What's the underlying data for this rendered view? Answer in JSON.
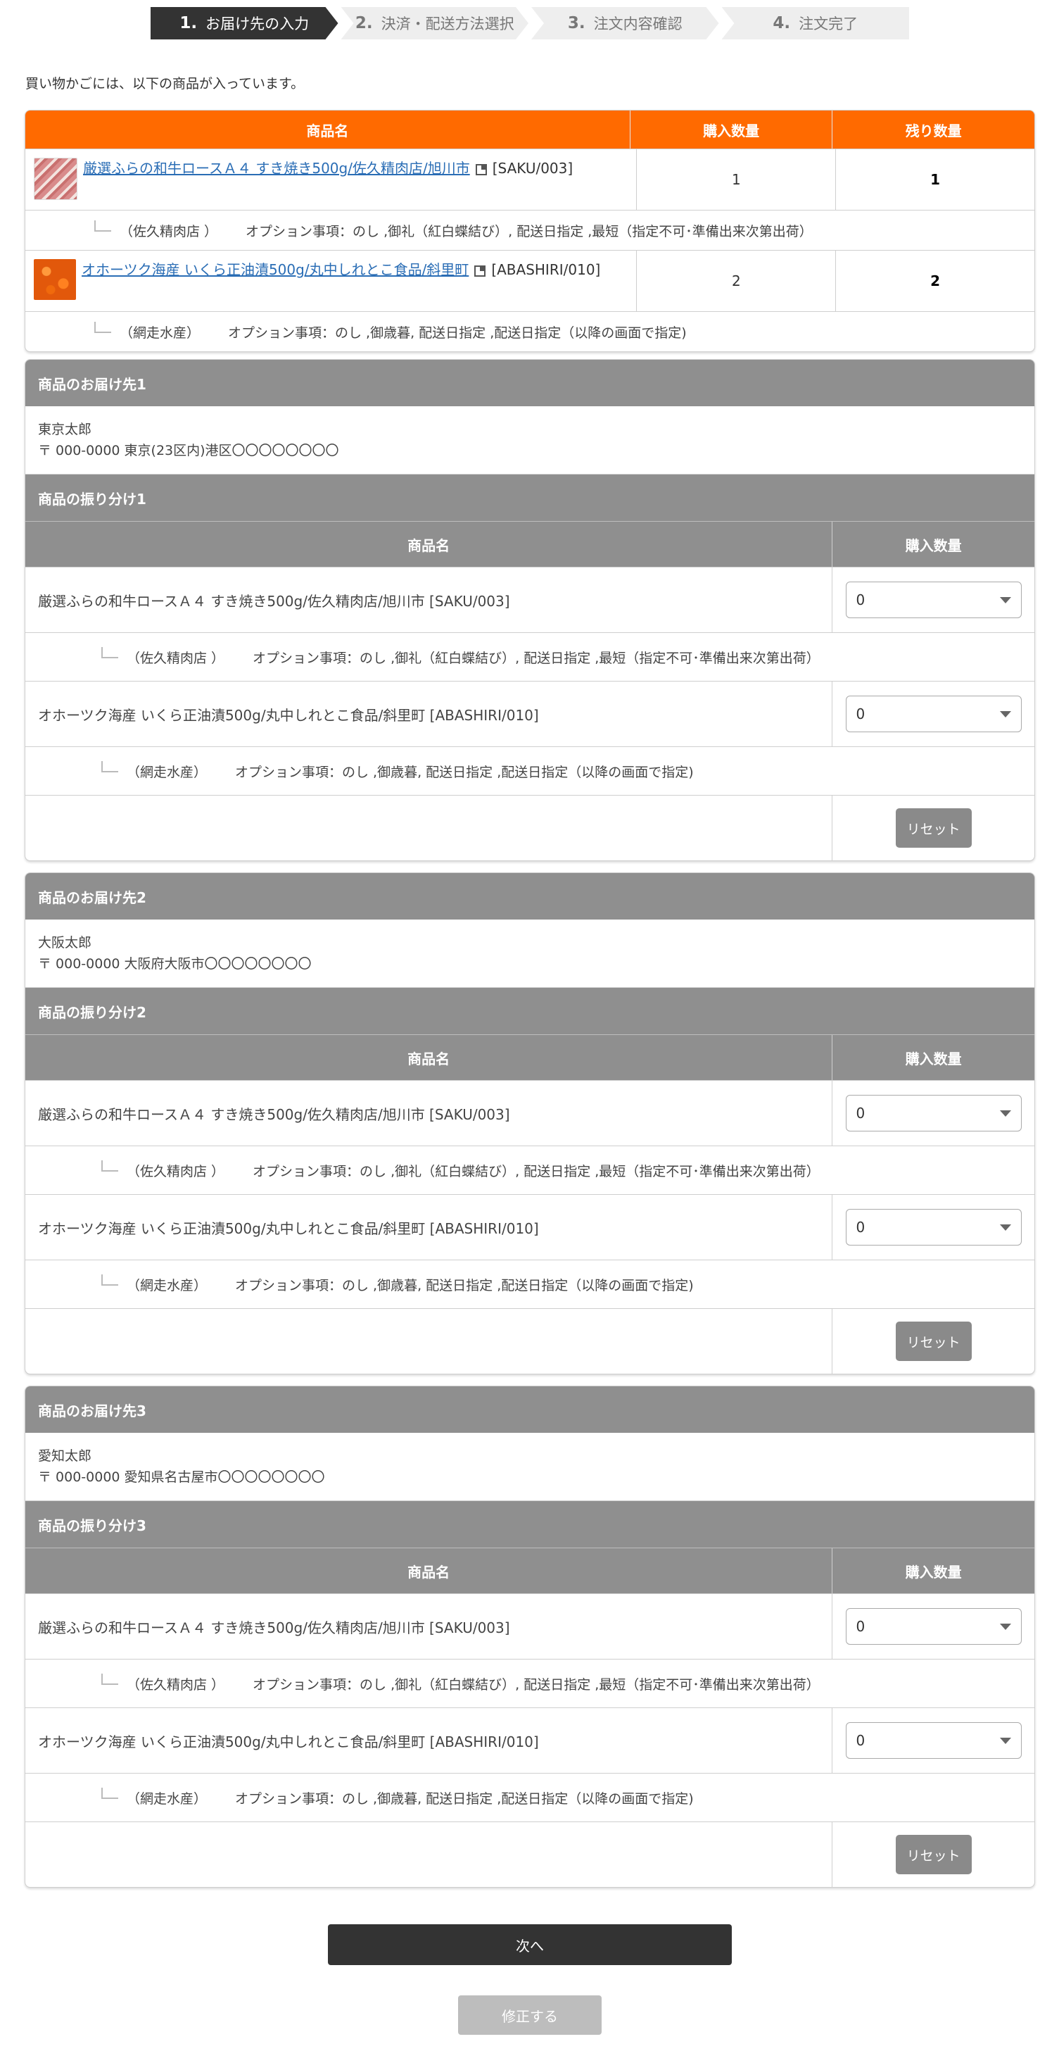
{
  "steps": [
    {
      "num": "1.",
      "label": "お届け先の入力",
      "active": true
    },
    {
      "num": "2.",
      "label": "決済・配送方法選択"
    },
    {
      "num": "3.",
      "label": "注文内容確認"
    },
    {
      "num": "4.",
      "label": "注文完了"
    }
  ],
  "intro": "買い物かごには、以下の商品が入っています。",
  "cart": {
    "headers": [
      "商品名",
      "購入数量",
      "残り数量"
    ],
    "items": [
      {
        "name_link": "厳選ふらの和牛ロースＡ４ すき焼き500g/佐久精肉店/旭川市",
        "code": "[SAKU/003]",
        "qty": "1",
        "remaining": "1",
        "shop": "（佐久精肉店 ）",
        "options": "オプション事項：のし ,御礼（紅白蝶結び）, 配送日指定 ,最短（指定不可･準備出来次第出荷）"
      },
      {
        "name_link": "オホーツク海産 いくら正油漬500g/丸中しれとこ食品/斜里町",
        "code": "[ABASHIRI/010]",
        "qty": "2",
        "remaining": "2",
        "shop": "（網走水産）",
        "options": "オプション事項：のし ,御歳暮, 配送日指定 ,配送日指定（以降の画面で指定)"
      }
    ]
  },
  "destinations": [
    {
      "title": "商品のお届け先1",
      "name": "東京太郎",
      "address": "〒 000-0000 東京(23区内)港区〇〇〇〇〇〇〇〇",
      "alloc_title": "商品の振り分け1",
      "rows": [
        {
          "product": "厳選ふらの和牛ロースＡ４ すき焼き500g/佐久精肉店/旭川市 [SAKU/003]",
          "value": "0",
          "shop": "（佐久精肉店 ）",
          "options": "オプション事項：のし ,御礼（紅白蝶結び）, 配送日指定 ,最短（指定不可･準備出来次第出荷）"
        },
        {
          "product": "オホーツク海産 いくら正油漬500g/丸中しれとこ食品/斜里町 [ABASHIRI/010]",
          "value": "0",
          "shop": "（網走水産）",
          "options": "オプション事項：のし ,御歳暮, 配送日指定 ,配送日指定（以降の画面で指定)"
        }
      ]
    },
    {
      "title": "商品のお届け先2",
      "name": "大阪太郎",
      "address": "〒 000-0000 大阪府大阪市〇〇〇〇〇〇〇〇",
      "alloc_title": "商品の振り分け2",
      "rows": [
        {
          "product": "厳選ふらの和牛ロースＡ４ すき焼き500g/佐久精肉店/旭川市 [SAKU/003]",
          "value": "0",
          "shop": "（佐久精肉店 ）",
          "options": "オプション事項：のし ,御礼（紅白蝶結び）, 配送日指定 ,最短（指定不可･準備出来次第出荷）"
        },
        {
          "product": "オホーツク海産 いくら正油漬500g/丸中しれとこ食品/斜里町 [ABASHIRI/010]",
          "value": "0",
          "shop": "（網走水産）",
          "options": "オプション事項：のし ,御歳暮, 配送日指定 ,配送日指定（以降の画面で指定)"
        }
      ]
    },
    {
      "title": "商品のお届け先3",
      "name": "愛知太郎",
      "address": "〒 000-0000 愛知県名古屋市〇〇〇〇〇〇〇〇",
      "alloc_title": "商品の振り分け3",
      "rows": [
        {
          "product": "厳選ふらの和牛ロースＡ４ すき焼き500g/佐久精肉店/旭川市 [SAKU/003]",
          "value": "0",
          "shop": "（佐久精肉店 ）",
          "options": "オプション事項：のし ,御礼（紅白蝶結び）, 配送日指定 ,最短（指定不可･準備出来次第出荷）"
        },
        {
          "product": "オホーツク海産 いくら正油漬500g/丸中しれとこ食品/斜里町 [ABASHIRI/010]",
          "value": "0",
          "shop": "（網走水産）",
          "options": "オプション事項：のし ,御歳暮, 配送日指定 ,配送日指定（以降の画面で指定)"
        }
      ]
    }
  ],
  "alloc_headers": [
    "商品名",
    "購入数量"
  ],
  "reset_label": "リセット",
  "next_label": "次へ",
  "fix_label": "修正する",
  "colors": {
    "accent": "#ff6a00",
    "header_gray": "#8f8f8f",
    "dark": "#333333"
  }
}
